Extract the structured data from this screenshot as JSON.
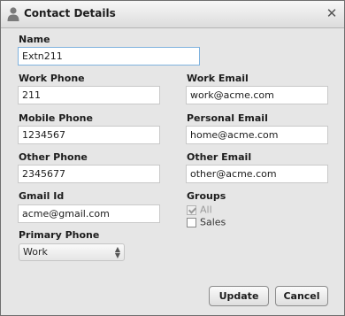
{
  "window": {
    "title": "Contact Details",
    "user_icon": "user-icon",
    "close_icon": "close-icon"
  },
  "form": {
    "name": {
      "label": "Name",
      "value": "Extn211"
    },
    "work_phone": {
      "label": "Work Phone",
      "value": "211"
    },
    "work_email": {
      "label": "Work Email",
      "value": "work@acme.com"
    },
    "mobile_phone": {
      "label": "Mobile Phone",
      "value": "1234567"
    },
    "personal_email": {
      "label": "Personal Email",
      "value": "home@acme.com"
    },
    "other_phone": {
      "label": "Other Phone",
      "value": "2345677"
    },
    "other_email": {
      "label": "Other Email",
      "value": "other@acme.com"
    },
    "gmail": {
      "label": "Gmail Id",
      "value": "acme@gmail.com"
    },
    "groups": {
      "label": "Groups",
      "items": [
        {
          "label": "All",
          "checked": true,
          "disabled": true
        },
        {
          "label": "Sales",
          "checked": false,
          "disabled": false
        }
      ]
    },
    "primary_phone": {
      "label": "Primary Phone",
      "selected": "Work"
    }
  },
  "buttons": {
    "update": "Update",
    "cancel": "Cancel"
  },
  "colors": {
    "dialog_bg": "#e6e6e6",
    "focus_border": "#7fb2de"
  }
}
